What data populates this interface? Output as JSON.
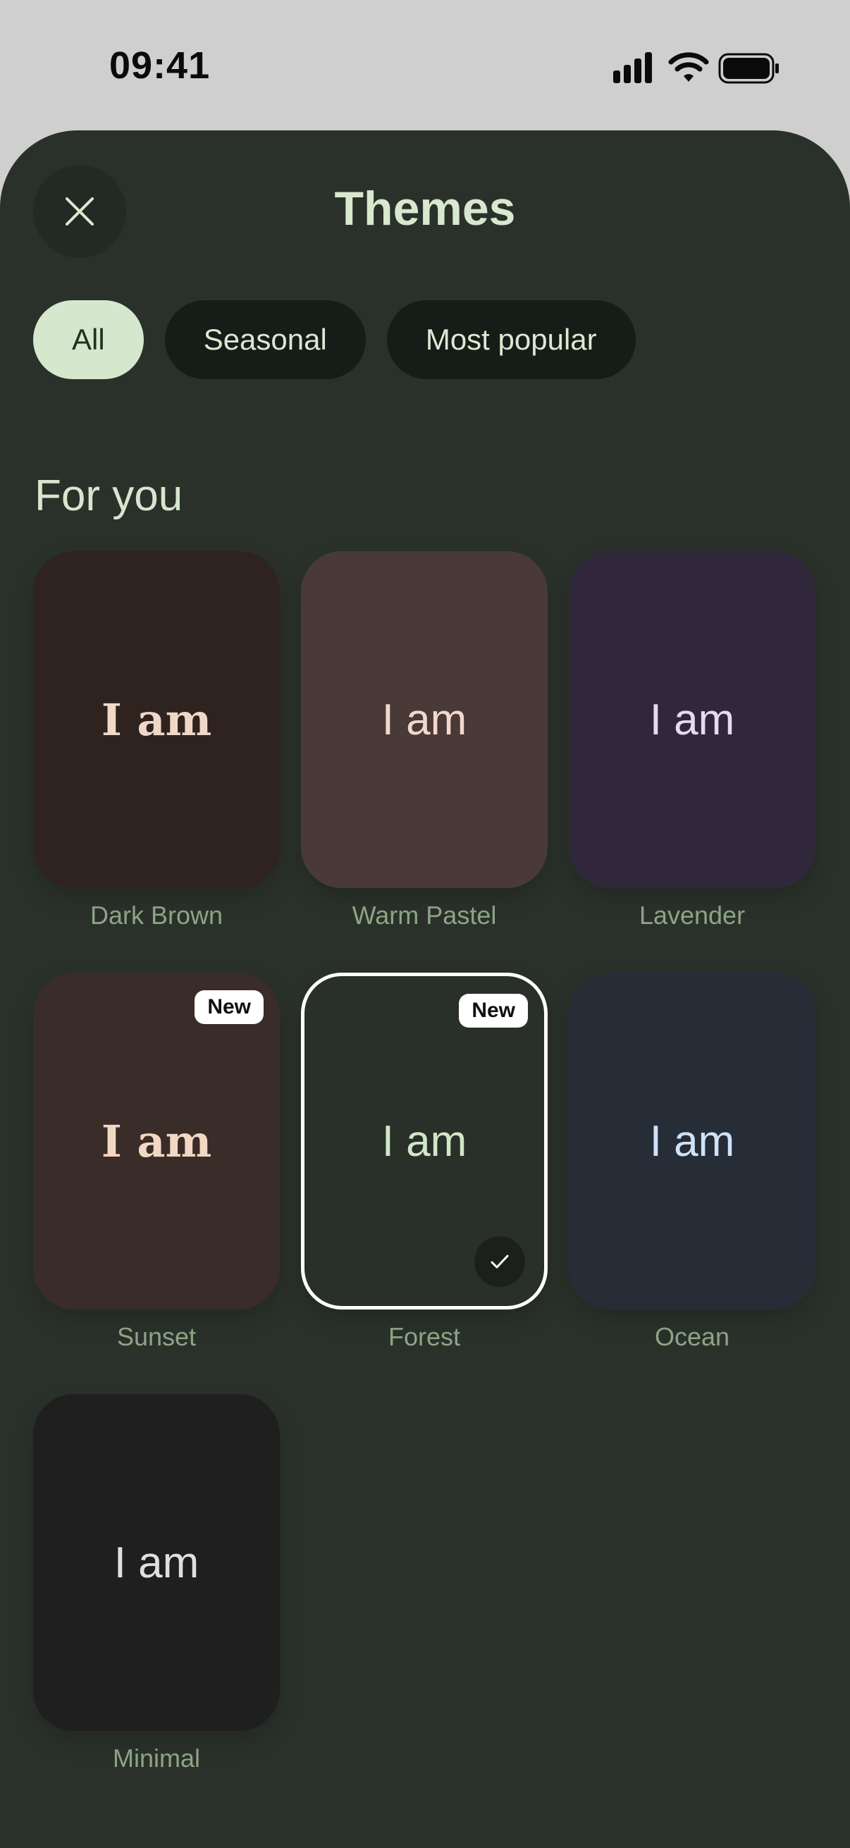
{
  "status": {
    "time": "09:41"
  },
  "header": {
    "title": "Themes",
    "close_icon": "close-icon"
  },
  "filters": [
    {
      "label": "All",
      "active": true
    },
    {
      "label": "Seasonal",
      "active": false
    },
    {
      "label": "Most popular",
      "active": false
    }
  ],
  "section": {
    "title": "For you"
  },
  "themes": [
    {
      "name": "Dark Brown",
      "preview": "I am",
      "bg": "#2f2320",
      "fg": "#f0d8c8",
      "font": "serif",
      "badge": "",
      "selected": false
    },
    {
      "name": "Warm Pastel",
      "preview": "I am",
      "bg": "#493a37",
      "fg": "#f3d8ce",
      "font": "sans",
      "badge": "",
      "selected": false
    },
    {
      "name": "Lavender",
      "preview": "I am",
      "bg": "#30283a",
      "fg": "#e7d8f3",
      "font": "sans",
      "badge": "",
      "selected": false
    },
    {
      "name": "Sunset",
      "preview": "I am",
      "bg": "#392c29",
      "fg": "#f2d8c3",
      "font": "serif",
      "badge": "New",
      "selected": false
    },
    {
      "name": "Forest",
      "preview": "I am",
      "bg": "#283029",
      "fg": "#d2e6c8",
      "font": "sans",
      "badge": "New",
      "selected": true
    },
    {
      "name": "Ocean",
      "preview": "I am",
      "bg": "#262d37",
      "fg": "#cfe2f8",
      "font": "sans",
      "badge": "",
      "selected": false
    },
    {
      "name": "Minimal",
      "preview": "I am",
      "bg": "#1f1f20",
      "fg": "#e0e0e0",
      "font": "sans",
      "badge": "",
      "selected": false
    }
  ],
  "colors": {
    "sheet_bg": "#2a312a",
    "accent": "#d5e8cd",
    "label": "#8ea587"
  }
}
